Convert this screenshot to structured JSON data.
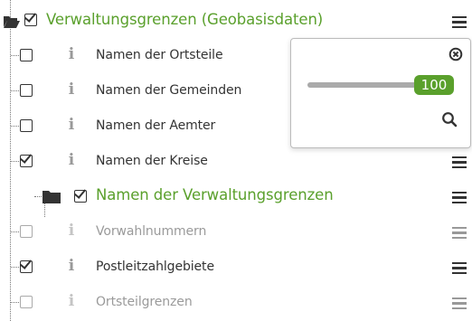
{
  "layer_group": {
    "title": "Verwaltungsgrenzen (Geobasisdaten)",
    "checked": true
  },
  "layers": [
    {
      "label": "Namen der Ortsteile",
      "checked": false,
      "disabled": false
    },
    {
      "label": "Namen der Gemeinden",
      "checked": false,
      "disabled": false
    },
    {
      "label": "Namen der Aemter",
      "checked": false,
      "disabled": false
    },
    {
      "label": "Namen der Kreise",
      "checked": true,
      "disabled": false
    },
    {
      "label": "Namen der Verwaltungsgrenzen",
      "checked": true,
      "disabled": false,
      "is_group": true
    },
    {
      "label": "Vorwahlnummern",
      "checked": false,
      "disabled": true
    },
    {
      "label": "Postleitzahlgebiete",
      "checked": true,
      "disabled": false
    },
    {
      "label": "Ortsteilgrenzen",
      "checked": false,
      "disabled": true
    }
  ],
  "opacity_popup": {
    "value": "100",
    "level_percent": 100
  },
  "icons": {
    "info": "i",
    "menu": "hamburger-menu-icon",
    "close": "close-circle-icon",
    "search": "search-icon",
    "folder": "folder-open-icon"
  },
  "colors": {
    "accent_green": "#5aa02c",
    "text": "#333333",
    "disabled_text": "#9a9a9a"
  }
}
